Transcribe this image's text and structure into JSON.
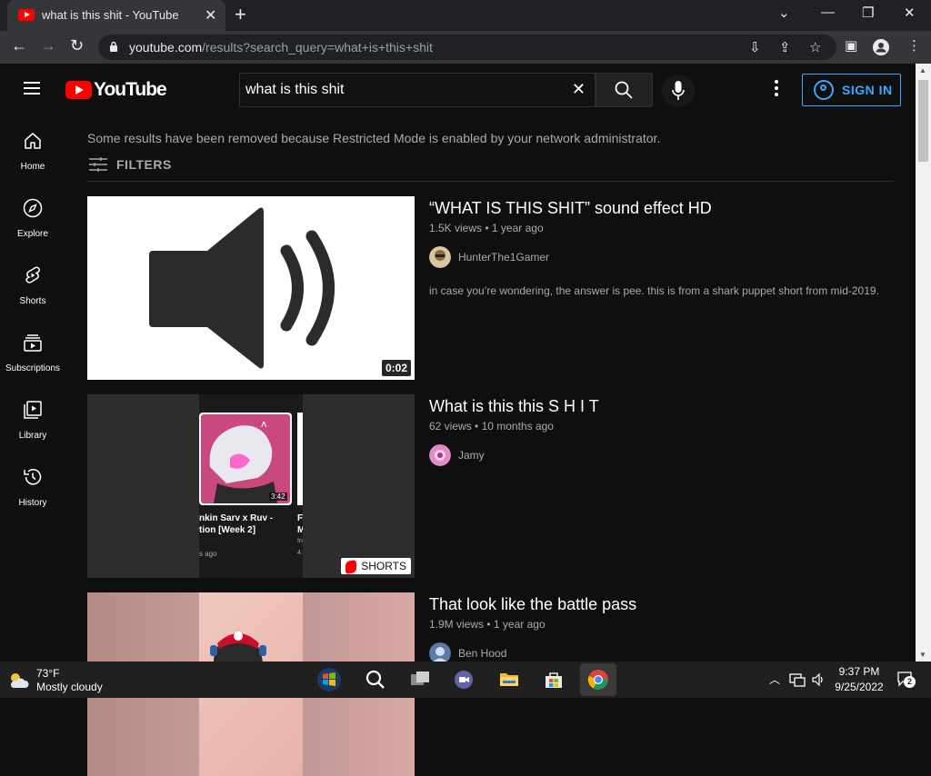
{
  "browser": {
    "tab_title": "what is this shit - YouTube",
    "url_host": "youtube.com",
    "url_path": "/results?search_query=what+is+this+shit"
  },
  "masthead": {
    "logo_text": "YouTube",
    "search_value": "what is this shit",
    "sign_in_label": "SIGN IN"
  },
  "guide": {
    "items": [
      {
        "label": "Home",
        "icon": "home-icon"
      },
      {
        "label": "Explore",
        "icon": "compass-icon"
      },
      {
        "label": "Shorts",
        "icon": "shorts-icon"
      },
      {
        "label": "Subscriptions",
        "icon": "subscriptions-icon"
      },
      {
        "label": "Library",
        "icon": "library-icon"
      },
      {
        "label": "History",
        "icon": "history-icon"
      }
    ]
  },
  "notice": "Some results have been removed because Restricted Mode is enabled by your network administrator.",
  "filters_label": "FILTERS",
  "results": [
    {
      "title": "“WHAT IS THIS SHIT” sound effect HD",
      "views": "1.5K views",
      "age": "1 year ago",
      "channel": "HunterThe1Gamer",
      "description": "in case you’re wondering, the answer is pee. this is from a shark puppet short from mid-2019.",
      "duration": "0:02"
    },
    {
      "title": "What is this this S H I T",
      "views": "62 views",
      "age": "10 months ago",
      "channel": "Jamy",
      "badge": "SHORTS",
      "thumb_text": {
        "time": "3:42",
        "line1": "nkin Sarv x Ruv -",
        "line2": "tion [Week 2]",
        "line3": "s ago",
        "right_line1": "F",
        "right_line2": "M",
        "right_line3": "In",
        "right_line4": "4."
      }
    },
    {
      "title": "That look like the battle pass",
      "views": "1.9M views",
      "age": "1 year ago",
      "channel": "Ben Hood"
    }
  ],
  "meta_separator": "•",
  "taskbar": {
    "temperature": "73°F",
    "condition": "Mostly cloudy",
    "time": "9:37 PM",
    "date": "9/25/2022",
    "notification_count": "2"
  },
  "colors": {
    "accent": "#3ea6ff",
    "brand": "#ff0000",
    "background": "#0f0f0f"
  }
}
